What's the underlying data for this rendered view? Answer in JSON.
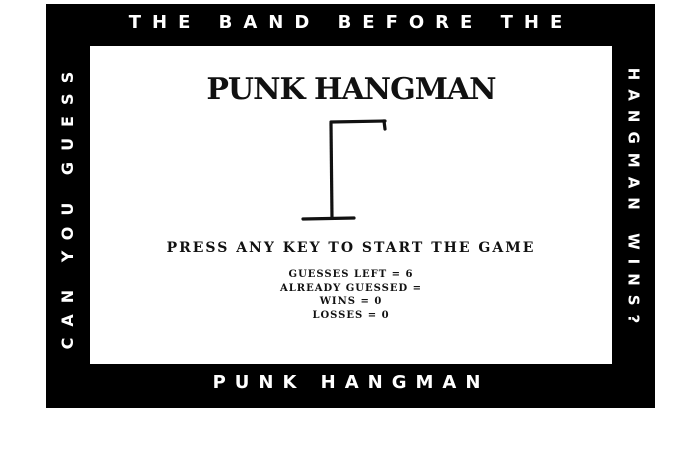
{
  "border": {
    "top": "THE BAND BEFORE THE",
    "right": "HANGMAN WINS?",
    "bottom": "PUNK HANGMAN",
    "left": "CAN YOU GUESS"
  },
  "game": {
    "title": "PUNK HANGMAN",
    "prompt": "PRESS ANY KEY TO START THE GAME",
    "guesses_left": "GUESSES LEFT = 6",
    "already_guessed": "ALREADY GUESSED =",
    "wins": "WINS = 0",
    "losses": "LOSSES = 0"
  },
  "colors": {
    "border": "#000000",
    "panel": "#ffffff",
    "ink": "#111111"
  },
  "icons": {
    "gallows": "gallows-drawing"
  }
}
